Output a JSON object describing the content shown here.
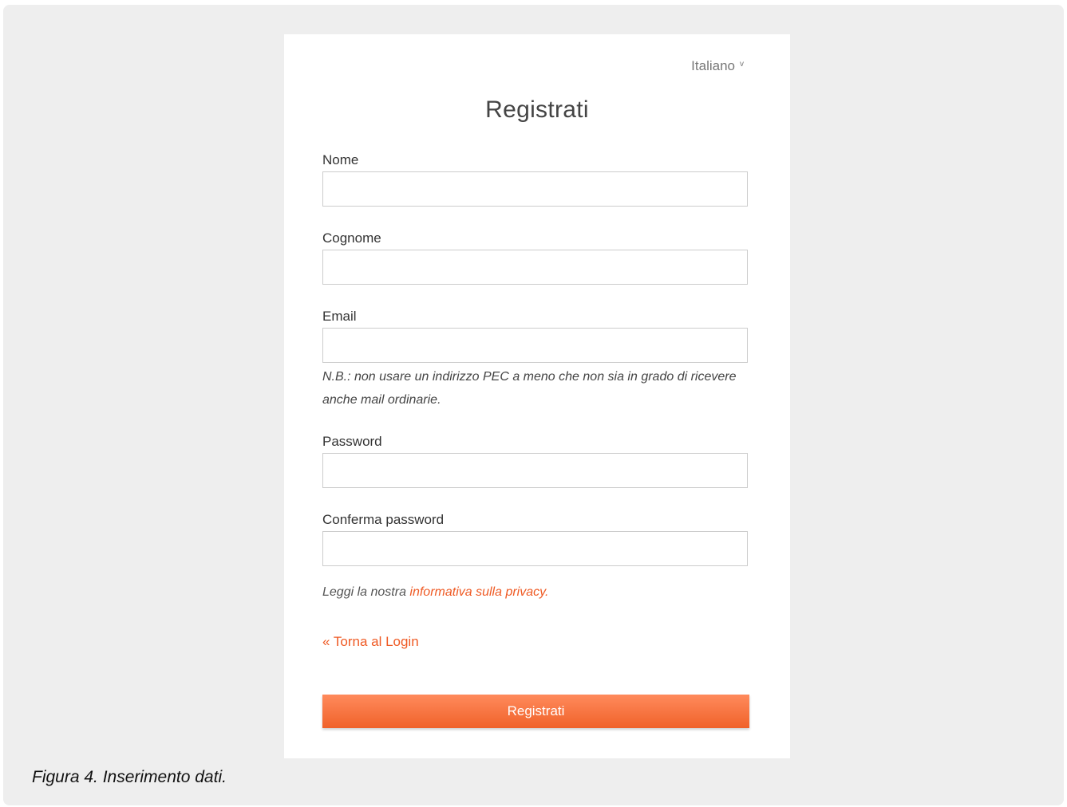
{
  "language_selector": {
    "label": "Italiano",
    "icon": "chevron-down-icon",
    "chevron": "v"
  },
  "form": {
    "title": "Registrati",
    "fields": [
      {
        "label": "Nome",
        "value": "",
        "placeholder": ""
      },
      {
        "label": "Cognome",
        "value": "",
        "placeholder": ""
      },
      {
        "label": "Email",
        "value": "",
        "placeholder": ""
      },
      {
        "label": "Password",
        "value": "",
        "placeholder": ""
      },
      {
        "label": "Conferma password",
        "value": "",
        "placeholder": ""
      }
    ],
    "email_note": "N.B.: non usare un indirizzo PEC a meno che non sia in grado di ricevere anche mail ordinarie.",
    "privacy_prefix": "Leggi la nostra ",
    "privacy_link": "informativa sulla privacy.",
    "back_link": "« Torna al Login",
    "submit_label": "Registrati"
  },
  "caption": "Figura 4. Inserimento dati.",
  "colors": {
    "accent": "#ef5a24",
    "button_top": "#ff8a5c",
    "button_bottom": "#f0622a",
    "page_background": "#eeeeee",
    "card_background": "#ffffff"
  }
}
